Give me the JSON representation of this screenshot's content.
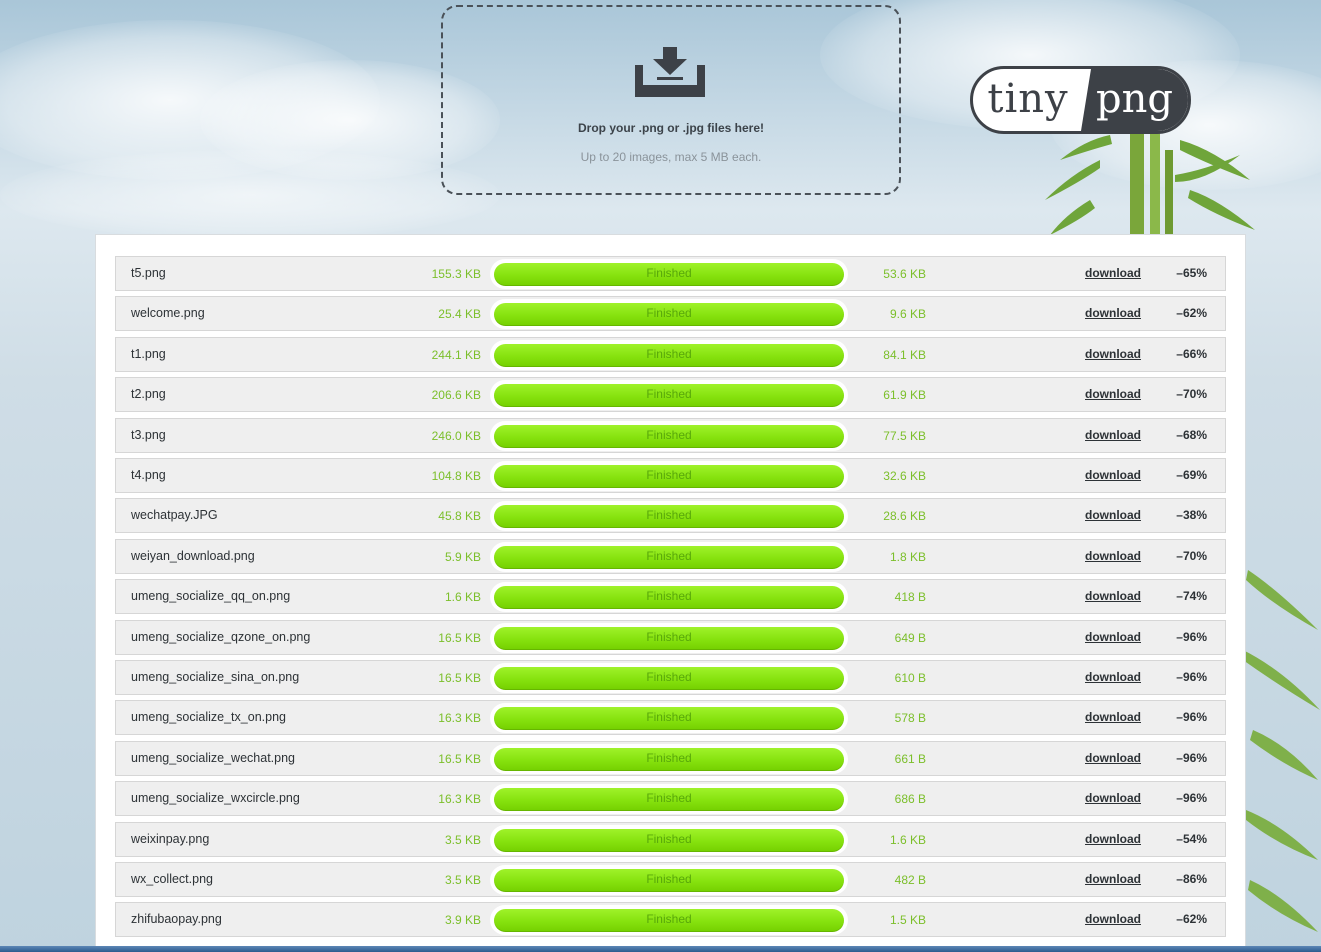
{
  "upload": {
    "icon": "download-tray-icon",
    "title": "Drop your .png or .jpg files here!",
    "subtitle": "Up to 20 images, max 5 MB each."
  },
  "logo": {
    "left": "tiny",
    "right": "png"
  },
  "colors": {
    "accent": "#86e20e",
    "dark": "#3d4147",
    "size_text": "#7bbf2a"
  },
  "files": [
    {
      "name": "t5.png",
      "original": "155.3 KB",
      "status": "Finished",
      "compressed": "53.6 KB",
      "action": "download",
      "saving": "–65%"
    },
    {
      "name": "welcome.png",
      "original": "25.4 KB",
      "status": "Finished",
      "compressed": "9.6 KB",
      "action": "download",
      "saving": "–62%"
    },
    {
      "name": "t1.png",
      "original": "244.1 KB",
      "status": "Finished",
      "compressed": "84.1 KB",
      "action": "download",
      "saving": "–66%"
    },
    {
      "name": "t2.png",
      "original": "206.6 KB",
      "status": "Finished",
      "compressed": "61.9 KB",
      "action": "download",
      "saving": "–70%"
    },
    {
      "name": "t3.png",
      "original": "246.0 KB",
      "status": "Finished",
      "compressed": "77.5 KB",
      "action": "download",
      "saving": "–68%"
    },
    {
      "name": "t4.png",
      "original": "104.8 KB",
      "status": "Finished",
      "compressed": "32.6 KB",
      "action": "download",
      "saving": "–69%"
    },
    {
      "name": "wechatpay.JPG",
      "original": "45.8 KB",
      "status": "Finished",
      "compressed": "28.6 KB",
      "action": "download",
      "saving": "–38%"
    },
    {
      "name": "weiyan_download.png",
      "original": "5.9 KB",
      "status": "Finished",
      "compressed": "1.8 KB",
      "action": "download",
      "saving": "–70%"
    },
    {
      "name": "umeng_socialize_qq_on.png",
      "original": "1.6 KB",
      "status": "Finished",
      "compressed": "418 B",
      "action": "download",
      "saving": "–74%"
    },
    {
      "name": "umeng_socialize_qzone_on.png",
      "original": "16.5 KB",
      "status": "Finished",
      "compressed": "649 B",
      "action": "download",
      "saving": "–96%"
    },
    {
      "name": "umeng_socialize_sina_on.png",
      "original": "16.5 KB",
      "status": "Finished",
      "compressed": "610 B",
      "action": "download",
      "saving": "–96%"
    },
    {
      "name": "umeng_socialize_tx_on.png",
      "original": "16.3 KB",
      "status": "Finished",
      "compressed": "578 B",
      "action": "download",
      "saving": "–96%"
    },
    {
      "name": "umeng_socialize_wechat.png",
      "original": "16.5 KB",
      "status": "Finished",
      "compressed": "661 B",
      "action": "download",
      "saving": "–96%"
    },
    {
      "name": "umeng_socialize_wxcircle.png",
      "original": "16.3 KB",
      "status": "Finished",
      "compressed": "686 B",
      "action": "download",
      "saving": "–96%"
    },
    {
      "name": "weixinpay.png",
      "original": "3.5 KB",
      "status": "Finished",
      "compressed": "1.6 KB",
      "action": "download",
      "saving": "–54%"
    },
    {
      "name": "wx_collect.png",
      "original": "3.5 KB",
      "status": "Finished",
      "compressed": "482 B",
      "action": "download",
      "saving": "–86%"
    },
    {
      "name": "zhifubaopay.png",
      "original": "3.9 KB",
      "status": "Finished",
      "compressed": "1.5 KB",
      "action": "download",
      "saving": "–62%"
    }
  ]
}
